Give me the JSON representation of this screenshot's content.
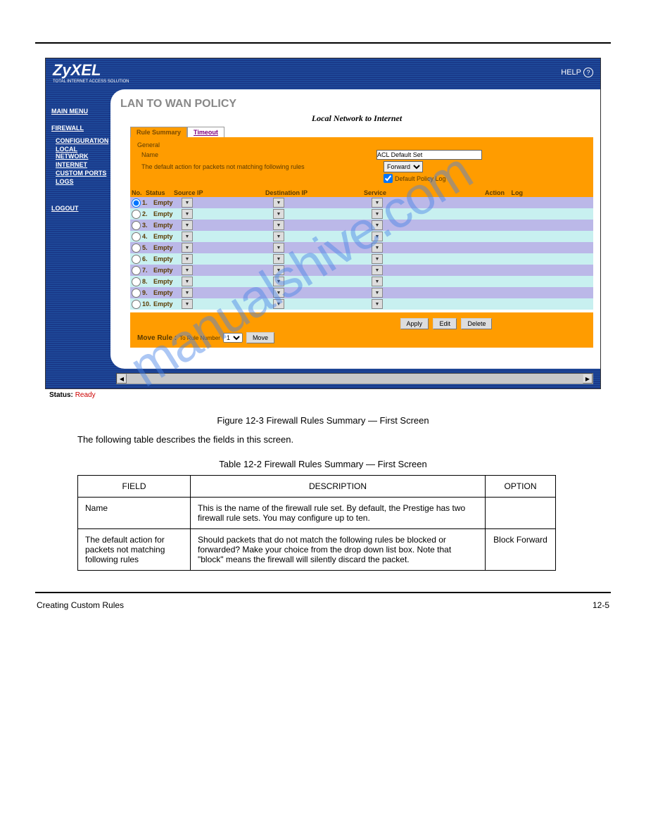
{
  "header": {
    "logo": "ZyXEL",
    "logo_sub": "TOTAL INTERNET ACCESS SOLUTION",
    "help": "HELP"
  },
  "sidebar": {
    "main_menu": "MAIN MENU",
    "firewall": "FIREWALL",
    "items": [
      "CONFIGURATION",
      "LOCAL NETWORK",
      "INTERNET",
      "CUSTOM PORTS",
      "LOGS"
    ],
    "logout": "LOGOUT"
  },
  "content": {
    "title": "LAN TO WAN POLICY",
    "subtitle": "Local Network to Internet",
    "tabs": {
      "active": "Rule Summary",
      "inactive": "Timeout"
    },
    "general": {
      "heading": "General",
      "name_label": "Name",
      "name_value": "ACL Default Set",
      "default_action_label": "The default action for packets not matching following rules",
      "default_action_value": "Forward",
      "policy_log_label": "Default Policy Log"
    },
    "columns": {
      "no": "No.",
      "status": "Status",
      "src": "Source IP",
      "dest": "Destination IP",
      "svc": "Service",
      "action": "Action",
      "log": "Log"
    },
    "rows": [
      {
        "n": "1.",
        "status": "Empty"
      },
      {
        "n": "2.",
        "status": "Empty"
      },
      {
        "n": "3.",
        "status": "Empty"
      },
      {
        "n": "4.",
        "status": "Empty"
      },
      {
        "n": "5.",
        "status": "Empty"
      },
      {
        "n": "6.",
        "status": "Empty"
      },
      {
        "n": "7.",
        "status": "Empty"
      },
      {
        "n": "8.",
        "status": "Empty"
      },
      {
        "n": "9.",
        "status": "Empty"
      },
      {
        "n": "10.",
        "status": "Empty"
      }
    ],
    "buttons": {
      "apply": "Apply",
      "edit": "Edit",
      "delete": "Delete",
      "move": "Move"
    },
    "move_rule": {
      "label": "Move Rule :",
      "to": "To Rule Number",
      "value": "1"
    }
  },
  "status_bar": {
    "label": "Status:",
    "value": "Ready"
  },
  "doc": {
    "caption": "Figure 12-3 Firewall Rules Summary — First Screen",
    "follow": "The following table describes the fields in this screen.",
    "table_caption": "Table 12-2 Firewall Rules Summary — First Screen",
    "table": {
      "h1": "FIELD",
      "h2": "DESCRIPTION",
      "h3": "OPTION",
      "r1c1": "Name",
      "r1c2": "This is the name of the firewall rule set. By default, the Prestige has two firewall rule sets. You may configure up to ten.",
      "r2c1": "The default action for packets not matching following rules",
      "r2c2": "Should packets that do not match the following rules be blocked or forwarded? Make your choice from the drop down list box. Note that \"block\" means the firewall will silently discard the packet.",
      "r2c3": "Block Forward"
    },
    "footer_left": "Creating Custom Rules",
    "footer_right": "12-5"
  },
  "watermark": "manualshive.com"
}
